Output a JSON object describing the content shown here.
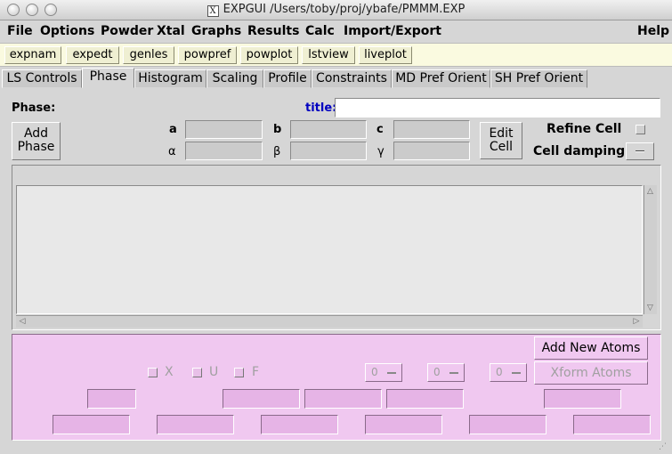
{
  "window": {
    "title": "EXPGUI /Users/toby/proj/ybafe/PMMM.EXP",
    "x_glyph": "X"
  },
  "menubar": [
    "File",
    "Options",
    "Powder",
    "Xtal",
    "Graphs",
    "Results",
    "Calc",
    "Import/Export",
    "Help"
  ],
  "toolbar": [
    "expnam",
    "expedt",
    "genles",
    "powpref",
    "powplot",
    "lstview",
    "liveplot"
  ],
  "tabs": [
    "LS Controls",
    "Phase",
    "Histogram",
    "Scaling",
    "Profile",
    "Constraints",
    "MD Pref Orient",
    "SH Pref Orient"
  ],
  "active_tab": "Phase",
  "phase": {
    "phase_label": "Phase:",
    "title_label": "title:",
    "title_value": "",
    "add_phase_line1": "Add",
    "add_phase_line2": "Phase",
    "cell": {
      "a": "a",
      "b": "b",
      "c": "c",
      "alpha": "α",
      "beta": "β",
      "gamma": "γ"
    },
    "edit_cell_line1": "Edit",
    "edit_cell_line2": "Cell",
    "refine_cell": "Refine Cell",
    "cell_damping": "Cell damping"
  },
  "atoms": {
    "add_new_atoms": "Add New Atoms",
    "xform_atoms": "Xform Atoms",
    "flag_x": "X",
    "flag_u": "U",
    "flag_f": "F",
    "damp_values": [
      "0",
      "0",
      "0"
    ]
  },
  "colors": {
    "atom_panel": "#f0c8f0",
    "title_label": "#0000c0",
    "toolbar_bg": "#fafae0"
  }
}
